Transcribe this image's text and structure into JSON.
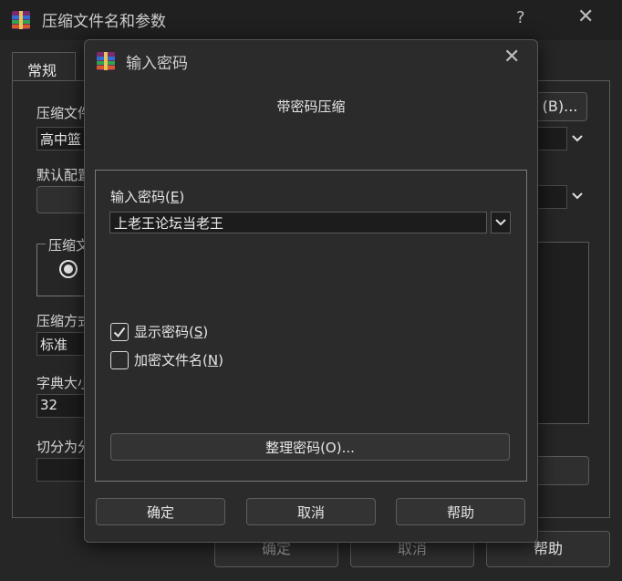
{
  "background_window": {
    "title": "压缩文件名和参数",
    "help_label": "?",
    "close_label": "✕",
    "tab_general": "常规",
    "archive_name_label": "压缩文件",
    "archive_name_value": "高中篮",
    "browse_button": "(B)...",
    "default_profile_label": "默认配置",
    "archive_format_label": "压缩文",
    "compression_method_label": "压缩方式",
    "compression_method_value": "标准",
    "dictionary_size_label": "字典大小",
    "dictionary_size_value": "32",
    "split_label": "切分为分",
    "ok_button": "确定",
    "cancel_button": "取消",
    "help_button": "帮助"
  },
  "dialog": {
    "title": "输入密码",
    "close_label": "✕",
    "heading": "带密码压缩",
    "password_label": "输入密码",
    "password_label_hotkey": "E",
    "password_value": "上老王论坛当老王",
    "show_password": {
      "label": "显示密码",
      "hotkey": "S",
      "checked": true
    },
    "encrypt_filenames": {
      "label": "加密文件名",
      "hotkey": "N",
      "checked": false
    },
    "organize_button": "整理密码(O)...",
    "ok_button": "确定",
    "cancel_button": "取消",
    "help_button": "帮助"
  }
}
